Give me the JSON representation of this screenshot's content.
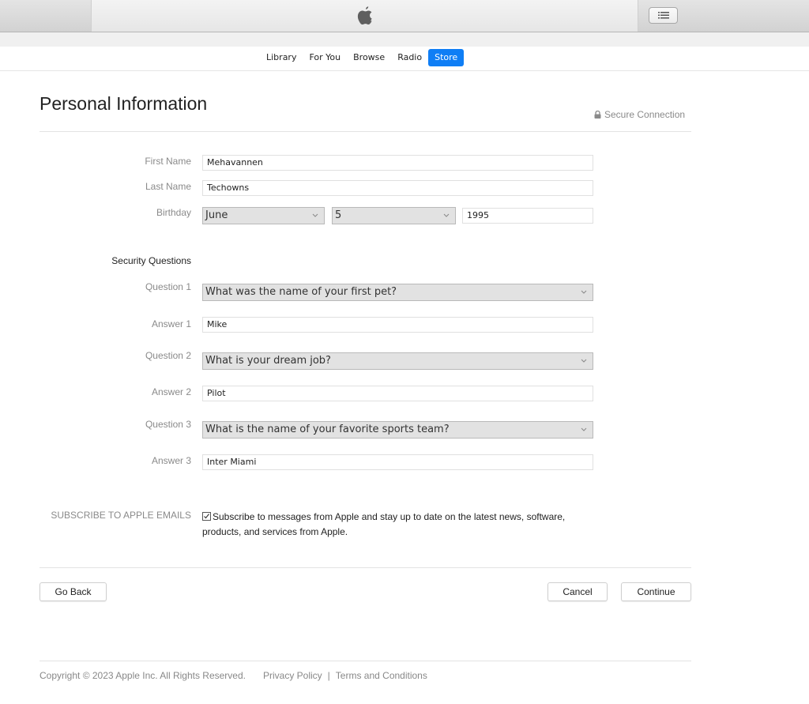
{
  "titlebar": {
    "logo_icon": "apple-logo-icon",
    "list_button_icon": "list-icon"
  },
  "nav": {
    "items": [
      {
        "label": "Library",
        "active": false
      },
      {
        "label": "For You",
        "active": false
      },
      {
        "label": "Browse",
        "active": false
      },
      {
        "label": "Radio",
        "active": false
      },
      {
        "label": "Store",
        "active": true
      }
    ],
    "accent_color": "#0f7ef5"
  },
  "header": {
    "title": "Personal Information",
    "secure_label": "Secure Connection",
    "secure_icon": "lock-icon"
  },
  "form": {
    "first_name": {
      "label": "First Name",
      "value": "Mehavannen"
    },
    "last_name": {
      "label": "Last Name",
      "value": "Techowns"
    },
    "birthday": {
      "label": "Birthday",
      "month": "June",
      "day": "5",
      "year": "1995"
    },
    "security_heading": "Security Questions",
    "questions": [
      {
        "question_label": "Question 1",
        "question": "What was the name of your first pet?",
        "answer_label": "Answer 1",
        "answer": "Mike"
      },
      {
        "question_label": "Question 2",
        "question": "What is your dream job?",
        "answer_label": "Answer 2",
        "answer": "Pilot"
      },
      {
        "question_label": "Question 3",
        "question": "What is the name of your favorite sports team?",
        "answer_label": "Answer 3",
        "answer": "Inter Miami"
      }
    ],
    "subscribe": {
      "label": "SUBSCRIBE TO APPLE EMAILS",
      "checked": true,
      "text": "Subscribe to messages from Apple and stay up to date on the latest news, software, products, and services from Apple."
    }
  },
  "buttons": {
    "go_back": "Go Back",
    "cancel": "Cancel",
    "continue": "Continue"
  },
  "footer": {
    "copyright": "Copyright © 2023 Apple Inc. All Rights Reserved.",
    "privacy": "Privacy Policy",
    "separator": "|",
    "terms": "Terms and Conditions"
  }
}
